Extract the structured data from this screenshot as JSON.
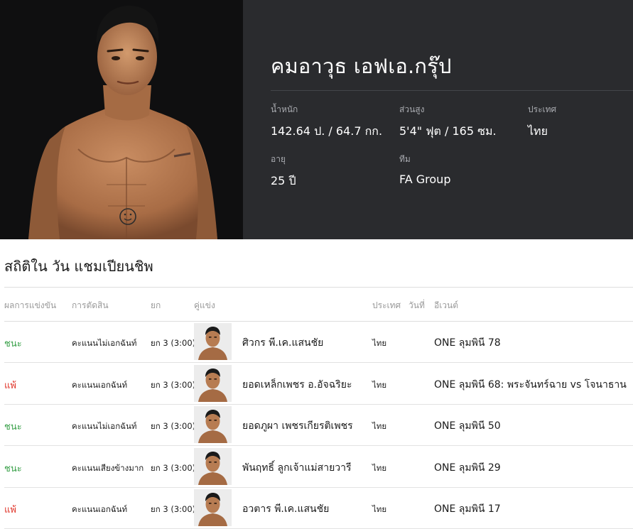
{
  "fighter": {
    "name": "คมอาวุธ เอฟเอ.กรุ๊ป",
    "attributes": [
      {
        "label": "น้ำหนัก",
        "value": "142.64 ป. / 64.7 กก."
      },
      {
        "label": "ส่วนสูง",
        "value": "5'4\" ฟุต / 165 ซม."
      },
      {
        "label": "ประเทศ",
        "value": "ไทย"
      },
      {
        "label": "อายุ",
        "value": "25 ปี"
      },
      {
        "label": "ทีม",
        "value": "FA Group"
      }
    ]
  },
  "record": {
    "title": "สถิติใน วัน แชมเปียนชิพ",
    "headers": [
      "ผลการแข่งขัน",
      "การตัดสิน",
      "ยก",
      "คู่แข่ง",
      "ประเทศ",
      "วันที่",
      "อีเวนต์"
    ],
    "rows": [
      {
        "result": "ชนะ",
        "outcome": "win",
        "method": "คะแนนไม่เอกฉันท์",
        "round": "ยก 3 (3:00)",
        "opponent": "ศิวกร พี.เค.แสนชัย",
        "country": "ไทย",
        "date": "",
        "event": "ONE ลุมพินี 78"
      },
      {
        "result": "แพ้",
        "outcome": "loss",
        "method": "คะแนนเอกฉันท์",
        "round": "ยก 3 (3:00)",
        "opponent": "ยอดเหล็กเพชร อ.อัจฉริยะ",
        "country": "ไทย",
        "date": "",
        "event": "ONE ลุมพินี 68: พระจันทร์ฉาย vs โจนาธาน"
      },
      {
        "result": "ชนะ",
        "outcome": "win",
        "method": "คะแนนไม่เอกฉันท์",
        "round": "ยก 3 (3:00)",
        "opponent": "ยอดภูผา เพชรเกียรติเพชร",
        "country": "ไทย",
        "date": "",
        "event": "ONE ลุมพินี 50"
      },
      {
        "result": "ชนะ",
        "outcome": "win",
        "method": "คะแนนเสียงข้างมาก",
        "round": "ยก 3 (3:00)",
        "opponent": "พันฤทธิ์ ลูกเจ้าแม่สายวารี",
        "country": "ไทย",
        "date": "",
        "event": "ONE ลุมพินี 29"
      },
      {
        "result": "แพ้",
        "outcome": "loss",
        "method": "คะแนนเอกฉันท์",
        "round": "ยก 3 (3:00)",
        "opponent": "อวตาร พี.เค.แสนชัย",
        "country": "ไทย",
        "date": "",
        "event": "ONE ลุมพินี 17"
      }
    ]
  },
  "colors": {
    "hero_bg": "#2a2b2e",
    "photo_bg": "#0f0f10",
    "win": "#3aa14a",
    "loss": "#e0362b"
  }
}
